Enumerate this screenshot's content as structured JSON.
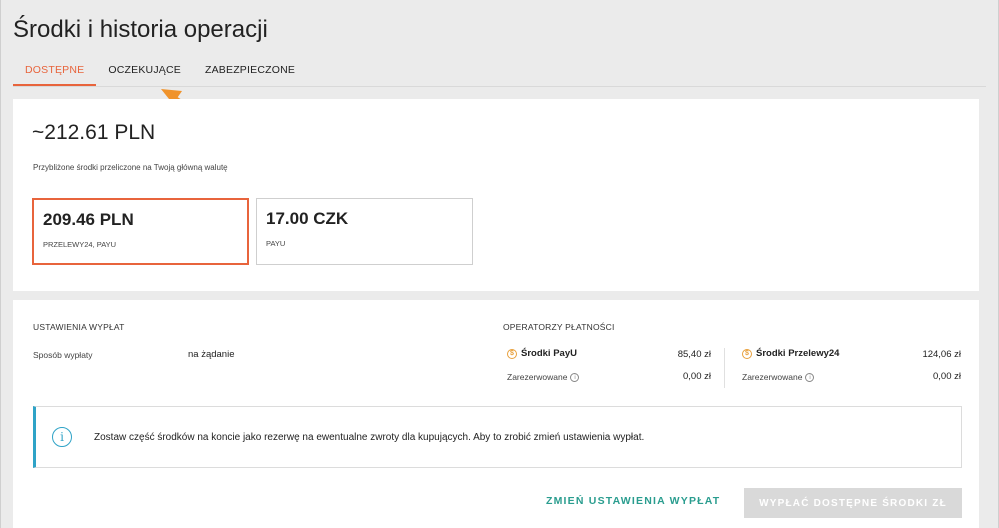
{
  "page": {
    "title": "Środki i historia operacji"
  },
  "tabs": [
    {
      "label": "DOSTĘPNE",
      "active": true
    },
    {
      "label": "OCZEKUJĄCE",
      "active": false
    },
    {
      "label": "ZABEZPIECZONE",
      "active": false
    }
  ],
  "summary": {
    "total": "~212.61 PLN",
    "note": "Przybliżone środki przeliczone na Twoją główną walutę",
    "balances": [
      {
        "amount": "209.46 PLN",
        "source": "PRZELEWY24, PAYU",
        "selected": true
      },
      {
        "amount": "17.00 CZK",
        "source": "PAYU",
        "selected": false
      }
    ]
  },
  "payout_settings": {
    "heading": "USTAWIENIA WYPŁAT",
    "method_label": "Sposób wypłaty",
    "method_value": "na żądanie"
  },
  "operators": {
    "heading": "OPERATORZY PŁATNOŚCI",
    "reserved_label": "Zarezerwowane",
    "items": [
      {
        "name": "Środki PayU",
        "amount": "85,40 zł",
        "reserved": "0,00 zł"
      },
      {
        "name": "Środki Przelewy24",
        "amount": "124,06 zł",
        "reserved": "0,00 zł"
      }
    ]
  },
  "notice": {
    "text": "Zostaw część środków na koncie jako rezerwę na ewentualne zwroty dla kupujących. Aby to zrobić zmień ustawienia wypłat."
  },
  "actions": {
    "change_settings": "ZMIEŃ USTAWIENIA WYPŁAT",
    "withdraw": "WYPŁAĆ DOSTĘPNE ŚRODKI ZŁ"
  },
  "colors": {
    "accent": "#e8643c",
    "info": "#2fa3c7",
    "link": "#2a9d8f",
    "annotation_arrow": "#f0932b"
  }
}
